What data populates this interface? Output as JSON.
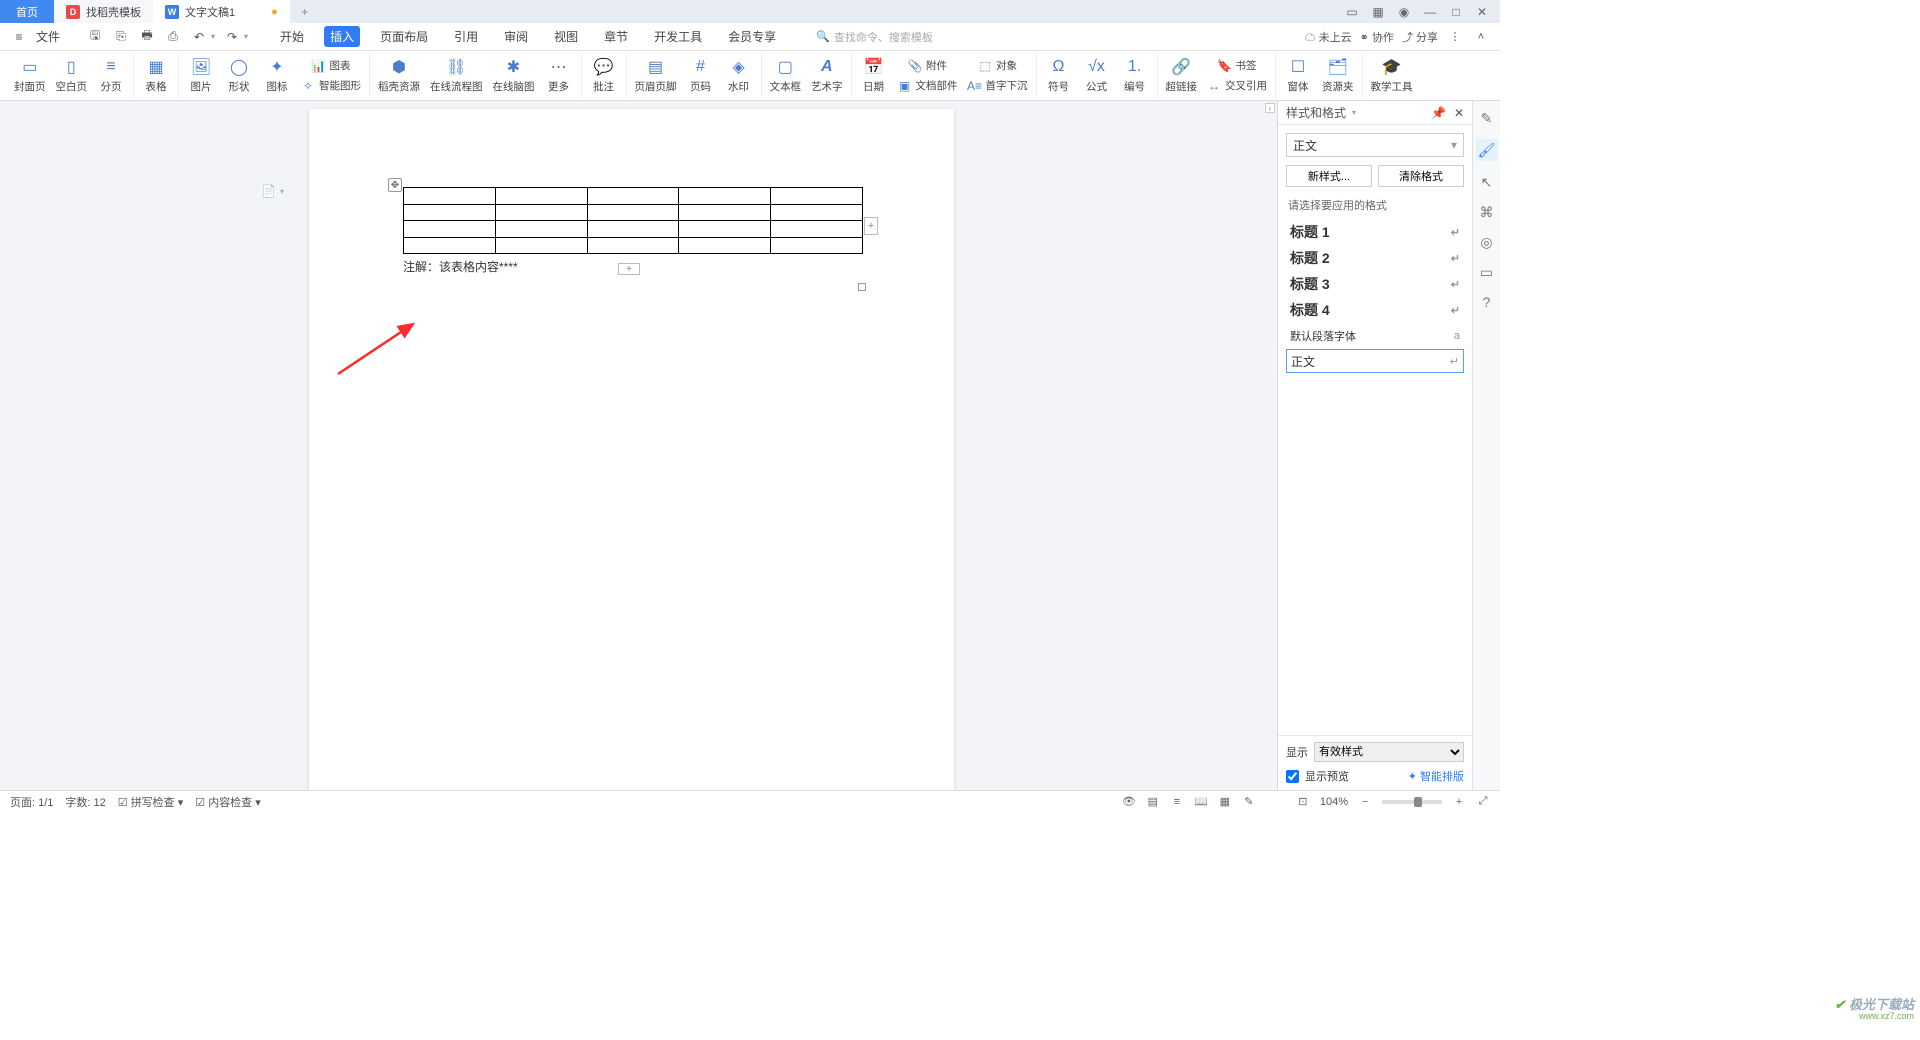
{
  "titlebar": {
    "home_label": "首页",
    "tab1_label": "找稻壳模板",
    "tab2_label": "文字文稿1",
    "modified_mark": "●",
    "add_label": "+"
  },
  "menubar": {
    "file_label": "文件",
    "search_placeholder": "查找命令、搜索模板",
    "cloud_label": "未上云",
    "coop_label": "协作",
    "share_label": "分享",
    "tabs": [
      "开始",
      "插入",
      "页面布局",
      "引用",
      "审阅",
      "视图",
      "章节",
      "开发工具",
      "会员专享"
    ]
  },
  "ribbon": {
    "cover": "封面页",
    "blank": "空白页",
    "break": "分页",
    "table": "表格",
    "picture": "图片",
    "shape": "形状",
    "icon": "图标",
    "chart": "图表",
    "smart": "智能图形",
    "docer": "稻壳资源",
    "flow": "在线流程图",
    "mind": "在线脑图",
    "more": "更多",
    "comment": "批注",
    "header": "页眉页脚",
    "pagenum": "页码",
    "watermark": "水印",
    "textbox": "文本框",
    "wordart": "艺术字",
    "date": "日期",
    "attach": "附件",
    "object": "对象",
    "firstdrop": "首字下沉",
    "docpart": "文档部件",
    "symbol": "符号",
    "formula": "公式",
    "number": "编号",
    "link": "超链接",
    "bookmark": "书签",
    "crossref": "交叉引用",
    "window": "窗体",
    "resource": "资源夹",
    "teach": "教学工具"
  },
  "document": {
    "caption": "注解：该表格内容****"
  },
  "styles_panel": {
    "title": "样式和格式",
    "current_style": "正文",
    "btn_new": "新样式...",
    "btn_clear": "清除格式",
    "hint": "请选择要应用的格式",
    "items": [
      {
        "label": "标题 1",
        "mark": "↵"
      },
      {
        "label": "标题 2",
        "mark": "↵"
      },
      {
        "label": "标题 3",
        "mark": "↵"
      },
      {
        "label": "标题 4",
        "mark": "↵"
      }
    ],
    "default_font": "默认段落字体",
    "default_mark": "a",
    "selected_item": "正文",
    "selected_mark": "↵",
    "display_label": "显示",
    "display_value": "有效样式",
    "preview_label": "显示预览",
    "smart_layout": "智能排版"
  },
  "statusbar": {
    "page": "页面: 1/1",
    "words": "字数: 12",
    "spell": "拼写检查",
    "content": "内容检查",
    "zoom": "104%"
  },
  "watermark": {
    "brand": "极光下载站",
    "url": "www.xz7.com"
  }
}
